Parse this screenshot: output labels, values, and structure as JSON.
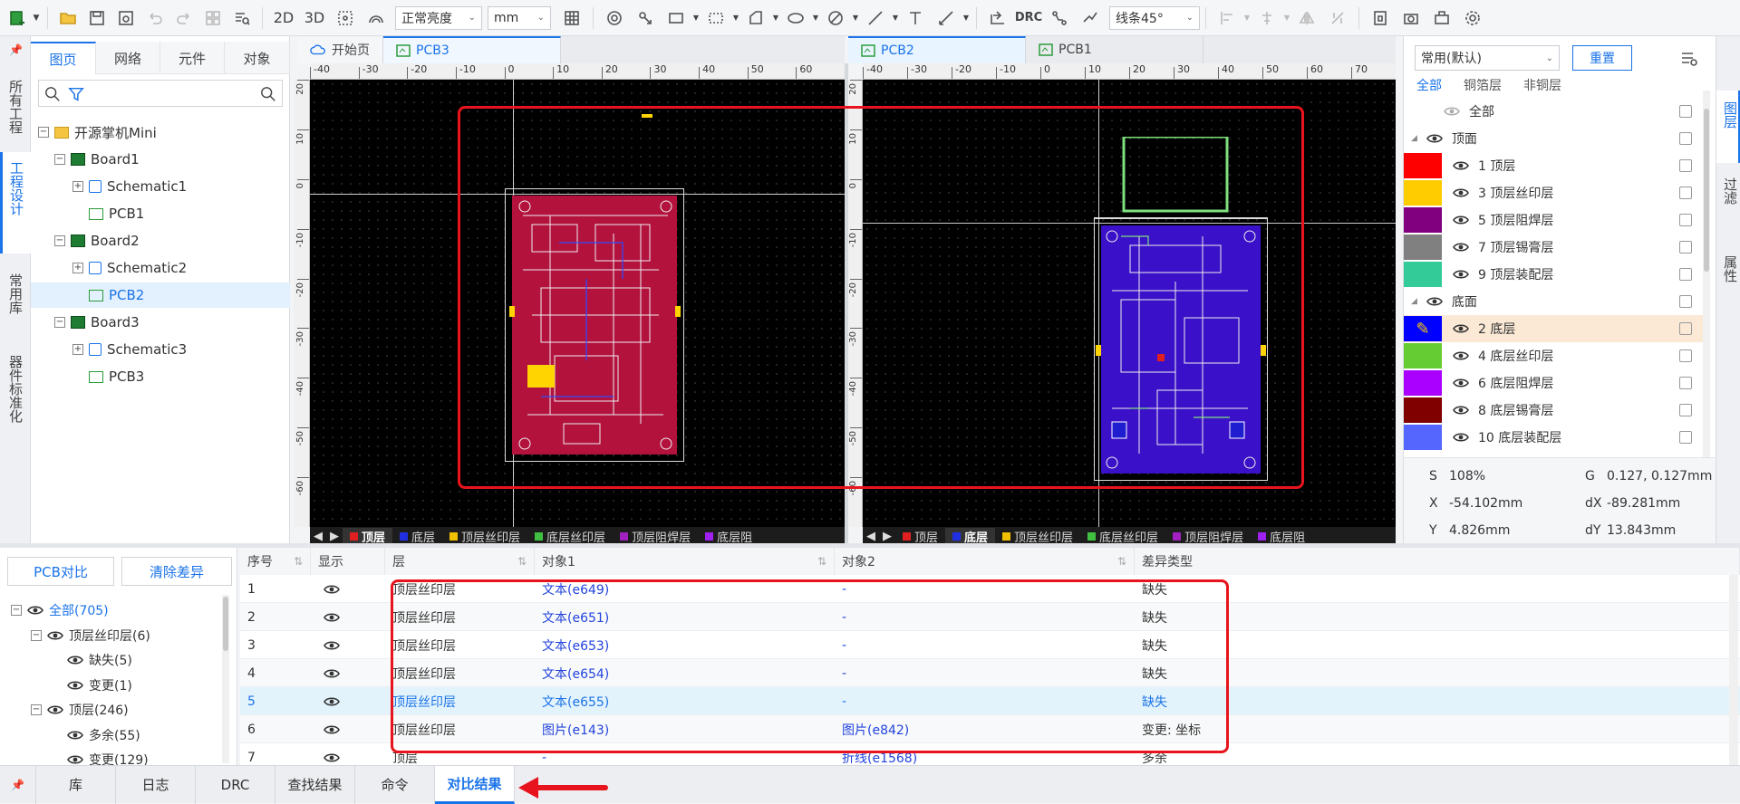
{
  "toolbar": {
    "btn_2d": "2D",
    "btn_3d": "3D",
    "brightness": "正常亮度",
    "unit": "mm",
    "drc": "DRC",
    "line_mode": "线条45°"
  },
  "left_rail": {
    "items": [
      "所有工程",
      "工程设计",
      "常用库",
      "器件标准化"
    ]
  },
  "project_panel": {
    "tabs": [
      "图页",
      "网络",
      "元件",
      "对象"
    ],
    "root": "开源掌机Mini",
    "boards": [
      {
        "name": "Board1",
        "schematic": "Schematic1",
        "pcb": "PCB1"
      },
      {
        "name": "Board2",
        "schematic": "Schematic2",
        "pcb": "PCB2"
      },
      {
        "name": "Board3",
        "schematic": "Schematic3",
        "pcb": "PCB3"
      }
    ]
  },
  "doc_tabs_left": [
    "开始页",
    "PCB3"
  ],
  "doc_tabs_right": [
    "PCB2",
    "PCB1"
  ],
  "ruler_left": [
    "-40",
    "-30",
    "-20",
    "-10",
    "0",
    "10",
    "20",
    "30",
    "40",
    "50",
    "60"
  ],
  "ruler_right": [
    "-40",
    "-30",
    "-20",
    "-10",
    "0",
    "10",
    "20",
    "30",
    "40",
    "50",
    "60",
    "70"
  ],
  "ruler_v": [
    "20",
    "10",
    "0",
    "-10",
    "-20",
    "-30",
    "-40",
    "-50",
    "-60"
  ],
  "layer_bar_left": [
    {
      "label": "顶层",
      "color": "#e02020"
    },
    {
      "label": "底层",
      "color": "#2030e0"
    },
    {
      "label": "顶层丝印层",
      "color": "#f0c000"
    },
    {
      "label": "底层丝印层",
      "color": "#40c040"
    },
    {
      "label": "顶层阻焊层",
      "color": "#a020c0"
    },
    {
      "label": "底层阻",
      "color": "#a020f0"
    }
  ],
  "layer_bar_right": [
    {
      "label": "顶层",
      "color": "#e02020"
    },
    {
      "label": "底层",
      "color": "#2030e0"
    },
    {
      "label": "顶层丝印层",
      "color": "#f0c000"
    },
    {
      "label": "底层丝印层",
      "color": "#40c040"
    },
    {
      "label": "顶层阻焊层",
      "color": "#a020c0"
    },
    {
      "label": "底层阻",
      "color": "#a020f0"
    }
  ],
  "right_panel": {
    "preset": "常用(默认)",
    "reset": "重置",
    "filters": [
      "全部",
      "铜箔层",
      "非铜层"
    ],
    "rows": [
      {
        "label": "全部",
        "color": ""
      },
      {
        "label": "顶面",
        "color": ""
      },
      {
        "label": "1 顶层",
        "color": "#ff0000"
      },
      {
        "label": "3 顶层丝印层",
        "color": "#ffcc00"
      },
      {
        "label": "5 顶层阻焊层",
        "color": "#800080"
      },
      {
        "label": "7 顶层锡膏层",
        "color": "#808080"
      },
      {
        "label": "9 顶层装配层",
        "color": "#33cc99"
      },
      {
        "label": "底面",
        "color": ""
      },
      {
        "label": "2 底层",
        "color": "#0000ff"
      },
      {
        "label": "4 底层丝印层",
        "color": "#66cc33"
      },
      {
        "label": "6 底层阻焊层",
        "color": "#aa00ff"
      },
      {
        "label": "8 底层锡膏层",
        "color": "#800000"
      },
      {
        "label": "10 底层装配层",
        "color": "#5566ff"
      }
    ],
    "status": {
      "s_label": "S",
      "s_value": "108%",
      "g_label": "G",
      "g_value": "0.127, 0.127mm",
      "x_label": "X",
      "x_value": "-54.102mm",
      "dx_label": "dX",
      "dx_value": "-89.281mm",
      "y_label": "Y",
      "y_value": "4.826mm",
      "dy_label": "dY",
      "dy_value": "13.843mm"
    }
  },
  "right_rail": [
    "图层",
    "过滤",
    "属性"
  ],
  "compare_panel": {
    "btn_compare": "PCB对比",
    "btn_clear": "清除差异",
    "tree": [
      {
        "label": "全部(705)",
        "level": 0,
        "sign": "−"
      },
      {
        "label": "顶层丝印层(6)",
        "level": 1,
        "sign": "−"
      },
      {
        "label": "缺失(5)",
        "level": 2,
        "sign": ""
      },
      {
        "label": "变更(1)",
        "level": 2,
        "sign": ""
      },
      {
        "label": "顶层(246)",
        "level": 1,
        "sign": "−"
      },
      {
        "label": "多余(55)",
        "level": 2,
        "sign": ""
      },
      {
        "label": "变更(129)",
        "level": 2,
        "sign": ""
      }
    ]
  },
  "diff_table": {
    "headers": [
      "序号",
      "显示",
      "层",
      "对象1",
      "对象2",
      "差异类型"
    ],
    "rows": [
      {
        "no": "1",
        "layer": "顶层丝印层",
        "obj1": "文本(e649)",
        "obj2": "-",
        "type": "缺失"
      },
      {
        "no": "2",
        "layer": "顶层丝印层",
        "obj1": "文本(e651)",
        "obj2": "-",
        "type": "缺失"
      },
      {
        "no": "3",
        "layer": "顶层丝印层",
        "obj1": "文本(e653)",
        "obj2": "-",
        "type": "缺失"
      },
      {
        "no": "4",
        "layer": "顶层丝印层",
        "obj1": "文本(e654)",
        "obj2": "-",
        "type": "缺失"
      },
      {
        "no": "5",
        "layer": "顶层丝印层",
        "obj1": "文本(e655)",
        "obj2": "-",
        "type": "缺失"
      },
      {
        "no": "6",
        "layer": "顶层丝印层",
        "obj1": "图片(e143)",
        "obj2": "图片(e842)",
        "type": "变更: 坐标"
      },
      {
        "no": "7",
        "layer": "顶层",
        "obj1": "-",
        "obj2": "折线(e1568)",
        "type": "多余"
      }
    ]
  },
  "bottom_tabs": [
    "库",
    "日志",
    "DRC",
    "查找结果",
    "命令",
    "对比结果"
  ],
  "colors": {
    "accent": "#1a73e8",
    "highlight_box": "#e8141d"
  }
}
